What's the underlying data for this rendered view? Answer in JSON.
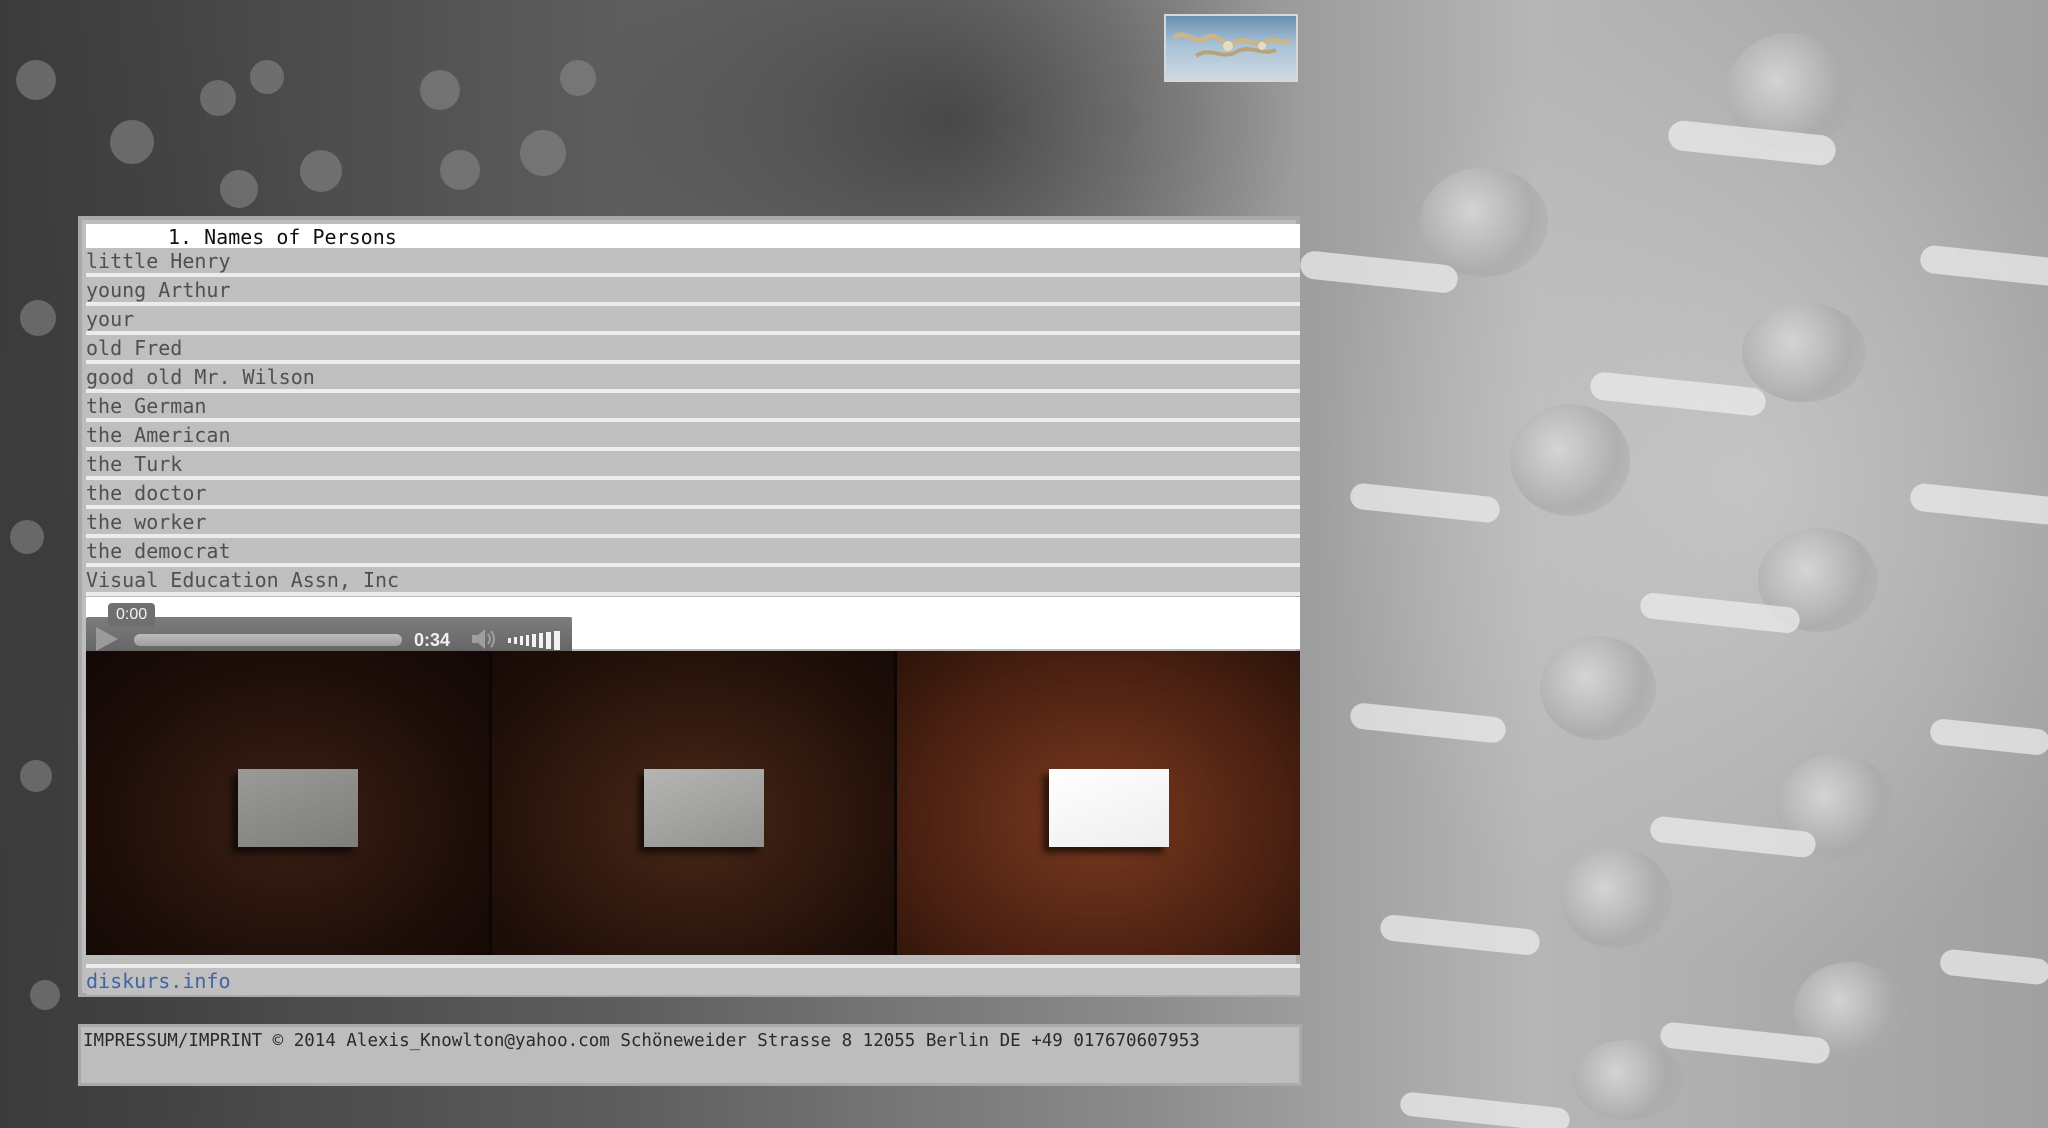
{
  "logo": {
    "icon": "seahorse-logo-icon"
  },
  "section": {
    "title": "1. Names of Persons"
  },
  "names": [
    "little Henry",
    "young Arthur",
    "your",
    "old Fred",
    "good old Mr. Wilson",
    "the German",
    "the American",
    "the Turk",
    "the doctor",
    "the worker",
    "the democrat",
    "Visual Education Assn, Inc"
  ],
  "audio_player": {
    "current_time": "0:00",
    "duration": "0:34",
    "progress": 0.0,
    "play_icon": "play-icon",
    "volume_icon": "speaker-icon"
  },
  "video": {
    "frames": 3
  },
  "link": {
    "text": "diskurs.info"
  },
  "footer": {
    "text": "IMPRESSUM/IMPRINT © 2014 Alexis_Knowlton@yahoo.com Schöneweider Strasse 8 12055 Berlin DE +49 017670607953"
  },
  "colors": {
    "link": "#3f64a8",
    "row_bg": "#bfbfbf",
    "row_separator": "#ececec"
  }
}
